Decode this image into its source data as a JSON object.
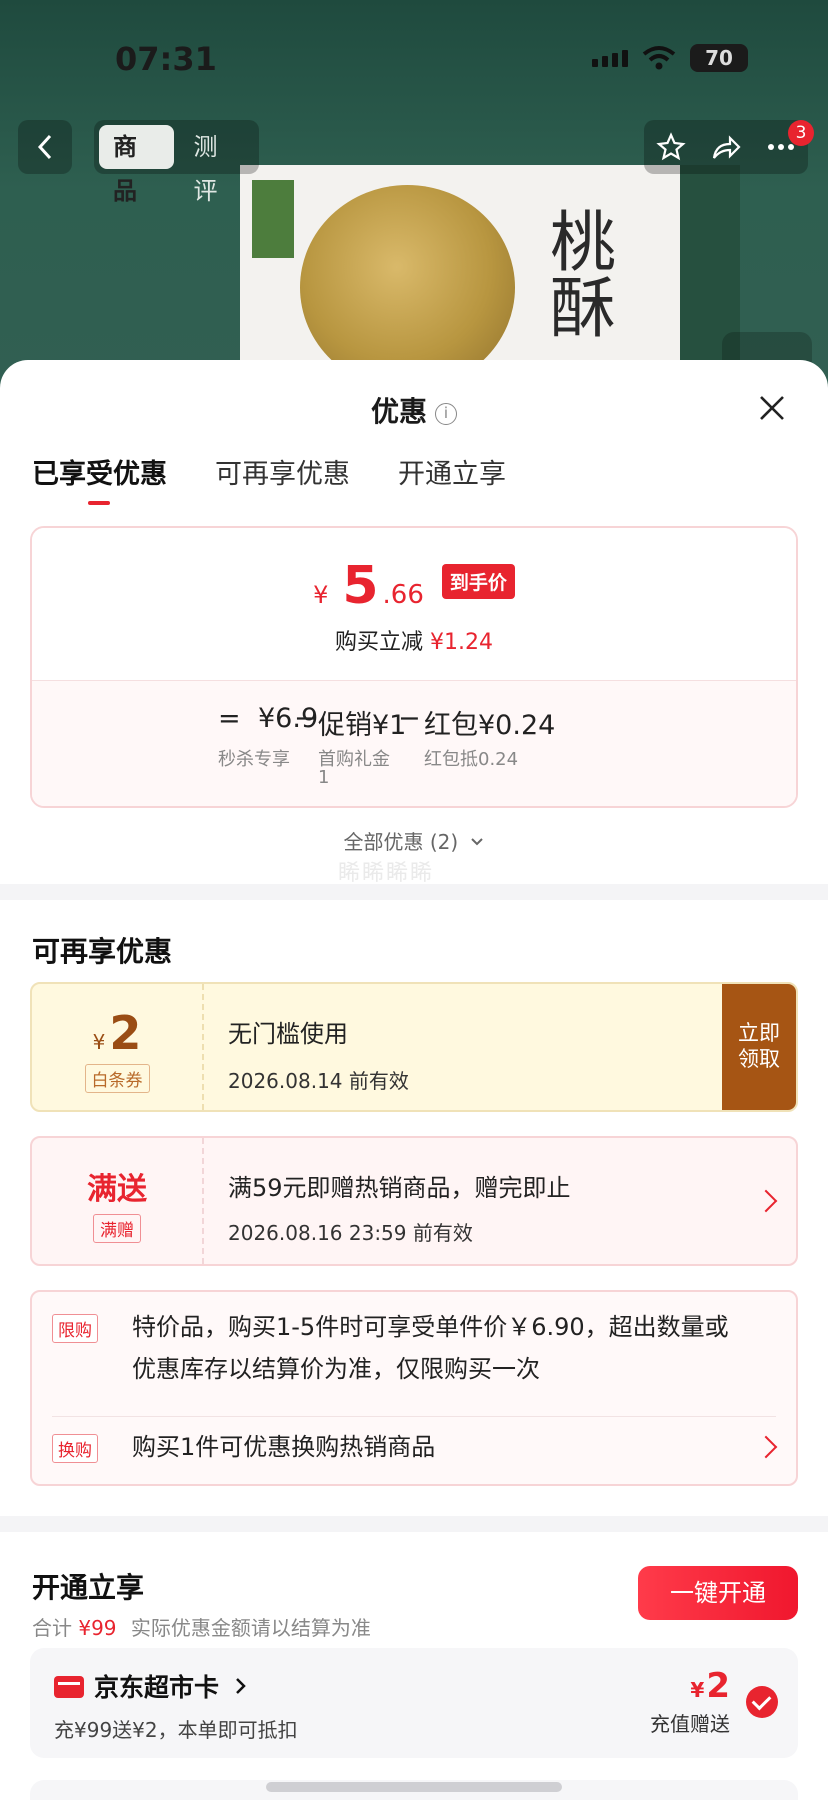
{
  "status_bar": {
    "time": "07:31",
    "battery": "70"
  },
  "product_nav": {
    "tabs": [
      {
        "label": "商品"
      },
      {
        "label": "测评"
      }
    ],
    "badge_count": "3",
    "package_text": "桃酥"
  },
  "sheet": {
    "title": "优惠",
    "tabs": [
      {
        "label": "已享受优惠"
      },
      {
        "label": "可再享优惠"
      },
      {
        "label": "开通立享"
      }
    ],
    "price_card": {
      "currency": "¥",
      "final_int": "5",
      "final_dec": ".66",
      "final_tag": "到手价",
      "reduce_text": "购买立减",
      "reduce_amount": "¥1.24",
      "formula": {
        "equals": "=",
        "base": "¥6.9",
        "base_label": "秒杀专享",
        "minus1": "−",
        "promo": "促销¥1",
        "promo_label_1": "首购礼金",
        "promo_label_2": "1",
        "minus2": "−",
        "redpack": "红包¥0.24",
        "redpack_label": "红包抵0.24"
      }
    },
    "all_offers": "全部优惠 (2)",
    "watermark": "睎睎睎睎",
    "more_offers": {
      "title": "可再享优惠",
      "coupon_baitiao": {
        "currency": "¥",
        "amount": "2",
        "type": "白条券",
        "title": "无门槛使用",
        "valid": "2026.08.14 前有效",
        "button": [
          "立即",
          "领取"
        ]
      },
      "coupon_gift": {
        "big": "满送",
        "type": "满赠",
        "title": "满59元即赠热销商品，赠完即止",
        "valid": "2026.08.16 23:59 前有效"
      },
      "promos": [
        {
          "label": "限购",
          "text": "特价品，购买1-5件时可享受单件价￥6.90，超出数量或优惠库存以结算价为准，仅限购买一次"
        },
        {
          "label": "换购",
          "text": "购买1件可优惠换购热销商品"
        }
      ]
    },
    "open_now": {
      "title": "开通立享",
      "total_label": "合计",
      "total_amount": "¥99",
      "note": "实际优惠金额请以结算为准",
      "button": "一键开通",
      "card": {
        "name": "京东超市卡",
        "desc": "充¥99送¥2，本单即可抵扣",
        "gift_currency": "¥",
        "gift_amount": "2",
        "gift_label": "充值赠送"
      }
    }
  },
  "colors": {
    "accent": "#e8242f",
    "coupon_brown": "#a65514",
    "coupon_bg": "#fff9df"
  }
}
